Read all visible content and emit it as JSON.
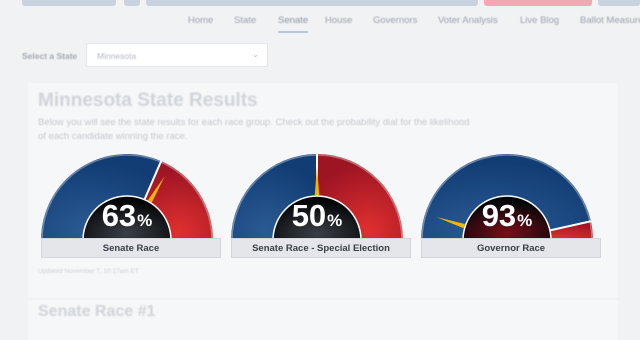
{
  "nav": {
    "items": [
      "Home",
      "State",
      "Senate",
      "House",
      "Governors",
      "Voter Analysis",
      "Live Blog",
      "Ballot Measures"
    ],
    "active": "Senate"
  },
  "state_select": {
    "label": "Select a State",
    "value": "Minnesota"
  },
  "results": {
    "title": "Minnesota State Results",
    "description": "Below you will see the state results for each race group. Check out the probability dial for the likelihood of each candidate winning the race.",
    "updated": "Updated November 7, 10:17am ET"
  },
  "gauges": [
    {
      "label": "Senate Race",
      "percent": "63",
      "percent_sign": "%",
      "value": 63,
      "winner": "dem",
      "needle": 0.67
    },
    {
      "label": "Senate Race - Special Election",
      "percent": "50",
      "percent_sign": "%",
      "value": 50,
      "winner": "even",
      "needle": 0.5
    },
    {
      "label": "Governor Race",
      "percent": "93",
      "percent_sign": "%",
      "value": 93,
      "winner": "dem",
      "needle": 0.1
    }
  ],
  "next_section": {
    "title": "Senate Race #1"
  },
  "colors": {
    "dem": "#123d74",
    "rep": "#c41f2e",
    "dem_glow": "#2b5a94",
    "rep_glow": "#e0302f",
    "needle": "#f2b705",
    "label_bg": "#e4e6e9",
    "page_bg": "#f1f2f4",
    "nav_active_underline": "#b9c8d8"
  }
}
